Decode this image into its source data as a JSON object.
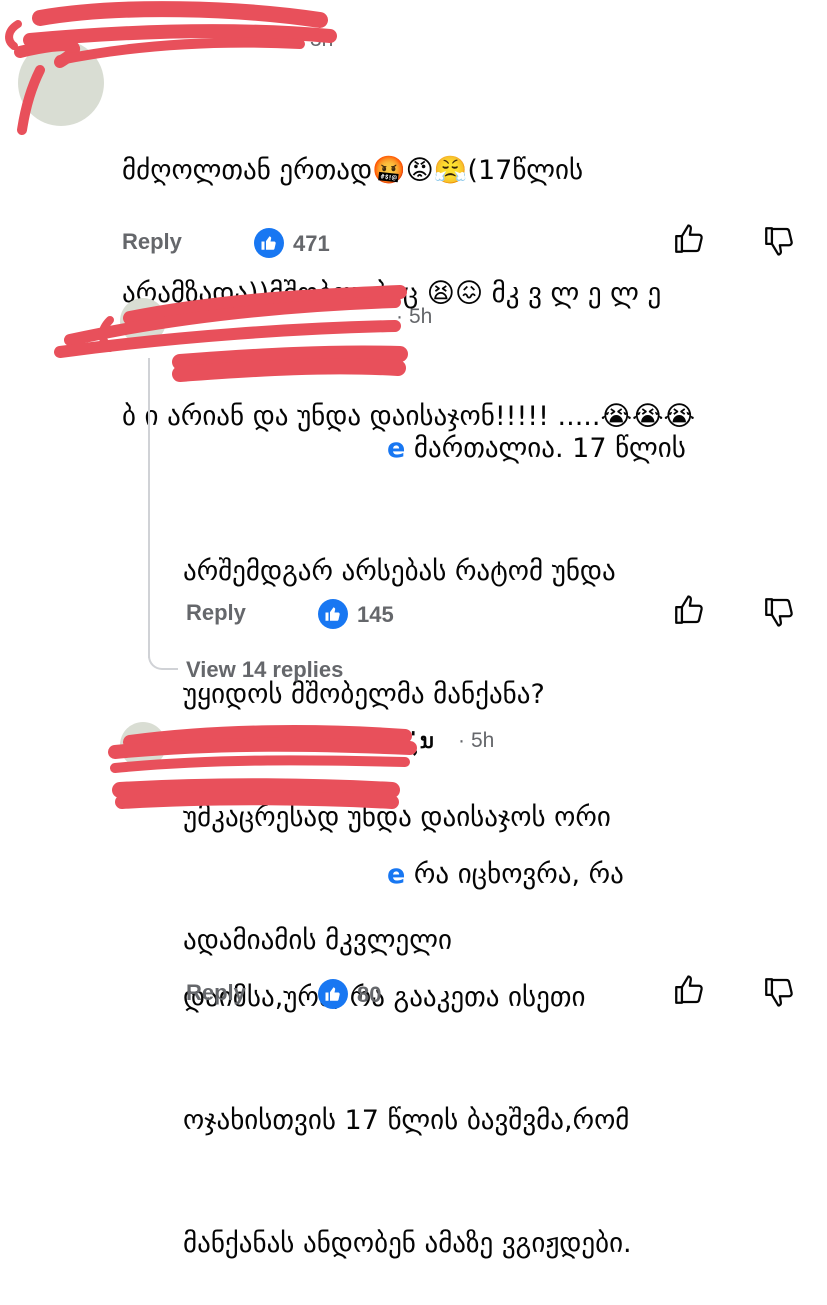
{
  "comments": [
    {
      "time": "3h",
      "text_lines": [
        "მძღოლთან ერთად🤬😡😤(17წლის",
        "არამზადა))მშობლებიც 😫😖 მკ ვ ლ ე ლ ე",
        "ბ ი არიან და უნდა დაისაჯონ!!!!! .....😭😭😭"
      ],
      "reply_label": "Reply",
      "likes": "471"
    },
    {
      "time_sep": "·",
      "time": "5h",
      "mention": "e",
      "text_lines": [
        "მართალია. 17 წლის",
        "არშემდგარ არსებას რატომ უნდა",
        "უყიდოს მშობელმა მანქანა?",
        "უმკაცრესად უნდა დაისაჯოს ორი",
        "ადამიამის მკვლელი"
      ],
      "reply_label": "Reply",
      "likes": "145",
      "view_replies": "View 14 replies"
    },
    {
      "name_tail": "ຸ່ນ",
      "time_sep": "·",
      "time": "5h",
      "mention": "e",
      "text_lines": [
        "რა იცხოვრა, რა",
        "დაიმსა,ურა, რა გააკეთა ისეთი",
        "ოჯახისთვის 17 წლის ბავშვმა,რომ",
        "მანქანას ანდობენ ამაზე ვგიჟდები."
      ],
      "reply_label": "Reply",
      "likes": "80"
    }
  ],
  "colors": {
    "scribble": "#e8505b",
    "like_blue": "#1877f2",
    "meta_gray": "#65676b"
  },
  "icons": [
    "like-badge-icon",
    "thumbs-up-icon",
    "thumbs-down-icon"
  ]
}
